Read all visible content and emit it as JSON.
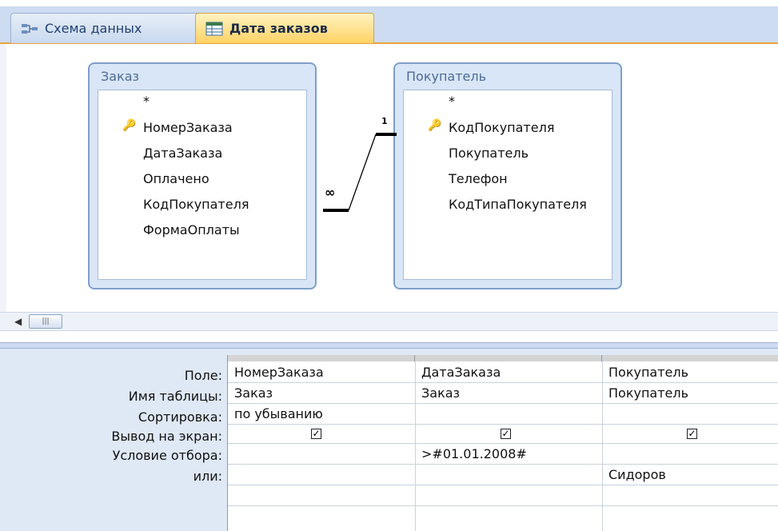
{
  "tabs": [
    {
      "label": "Схема данных",
      "active": false
    },
    {
      "label": "Дата заказов",
      "active": true
    }
  ],
  "tables": [
    {
      "title": "Заказ",
      "fields": [
        "*",
        "НомерЗаказа",
        "ДатаЗаказа",
        "Оплачено",
        "КодПокупателя",
        "ФормаОплаты"
      ],
      "key_field": "НомерЗаказа"
    },
    {
      "title": "Покупатель",
      "fields": [
        "*",
        "КодПокупателя",
        "Покупатель",
        "Телефон",
        "КодТипаПокупателя"
      ],
      "key_field": "КодПокупателя"
    }
  ],
  "relationship": {
    "one_side": "1",
    "many_side": "∞"
  },
  "grid": {
    "row_labels": [
      "Поле:",
      "Имя таблицы:",
      "Сортировка:",
      "Вывод на экран:",
      "Условие отбора:",
      "или:"
    ],
    "columns": [
      {
        "field": "НомерЗаказа",
        "table": "Заказ",
        "sort": "по убыванию",
        "show": true,
        "criteria": "",
        "or": ""
      },
      {
        "field": "ДатаЗаказа",
        "table": "Заказ",
        "sort": "",
        "show": true,
        "criteria": ">#01.01.2008#",
        "or": ""
      },
      {
        "field": "Покупатель",
        "table": "Покупатель",
        "sort": "",
        "show": true,
        "criteria": "",
        "or": "Сидоров"
      }
    ]
  },
  "colors": {
    "accent": "#ffd264",
    "frame": "#7f9fcb",
    "panel": "#dfe8f5"
  }
}
